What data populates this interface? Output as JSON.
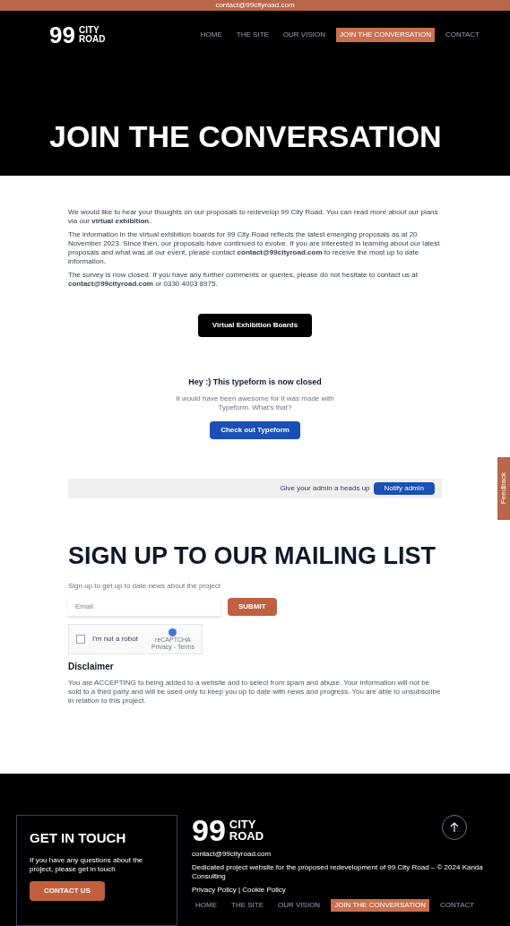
{
  "top_bar": {
    "email": "contact@99cityroad.com"
  },
  "header": {
    "logo": {
      "number": "99",
      "line1": "CITY",
      "line2": "ROAD"
    },
    "nav": [
      {
        "label": "HOME",
        "selected": false
      },
      {
        "label": "THE SITE",
        "selected": false
      },
      {
        "label": "OUR VISION",
        "selected": false
      },
      {
        "label": "JOIN THE CONVERSATION",
        "selected": true
      },
      {
        "label": "CONTACT",
        "selected": false
      }
    ],
    "title": "JOIN THE CONVERSATION"
  },
  "intro": [
    "We would like to hear your thoughts on our proposals to redevelop 99 City Road. You can read more about our plans via our **virtual exhibition**.",
    "The information in the virtual exhibition boards for 99 City Road reflects the latest emerging proposals as at 20 November 2023. Since then, our proposals have continued to evolve. If you are interested in learning about our latest proposals and what was at our event, please contact **contact@99cityroad.com** to receive the most up to date information.",
    "The survey is now closed. If you have any further comments or queries, please do not hesitate to contact us at **contact@99cityroad.com** or 0330 4003 8975."
  ],
  "exhibition_button": "Virtual Exhibition Boards",
  "typeform": {
    "heading": "Hey :) This typeform is now closed",
    "message": "It would have been awesome for it was made with Typeform. What's that?",
    "button": "Check out Typeform",
    "footer_text": "Give your admin a heads up",
    "footer_button": "Notify admin"
  },
  "side_tab": "Feedback",
  "mailing": {
    "title": "SIGN UP TO OUR MAILING LIST",
    "subtitle": "Sign up to get up to date news about the project",
    "email_placeholder": "Email",
    "submit": "SUBMIT",
    "captcha": {
      "label": "I'm not a robot",
      "checked": false,
      "brand": "reCAPTCHA",
      "terms": "Privacy - Terms"
    },
    "disclaimer_title": "Disclaimer",
    "disclaimer": "You are ACCEPTING to being added to a website and to select from spam and abuse. Your information will not be sold to a third party and will be used only to keep you up to date with news and progress. You are able to unsubscribe in relation to this project."
  },
  "footer": {
    "get_in_touch": {
      "title": "GET IN TOUCH",
      "text": "If you have any questions about the project, please get in touch",
      "button": "CONTACT US"
    },
    "logo": {
      "number": "99",
      "line1": "CITY",
      "line2": "ROAD"
    },
    "email": "contact@99cityroad.com",
    "description": "Dedicated project website for the proposed redevelopment of 99 City Road – © 2024 Kanda Consulting",
    "legal": "Privacy Policy | Cookie Policy",
    "nav": [
      {
        "label": "HOME",
        "selected": false
      },
      {
        "label": "THE SITE",
        "selected": false
      },
      {
        "label": "OUR VISION",
        "selected": false
      },
      {
        "label": "JOIN THE CONVERSATION",
        "selected": true
      },
      {
        "label": "CONTACT",
        "selected": false
      }
    ]
  }
}
